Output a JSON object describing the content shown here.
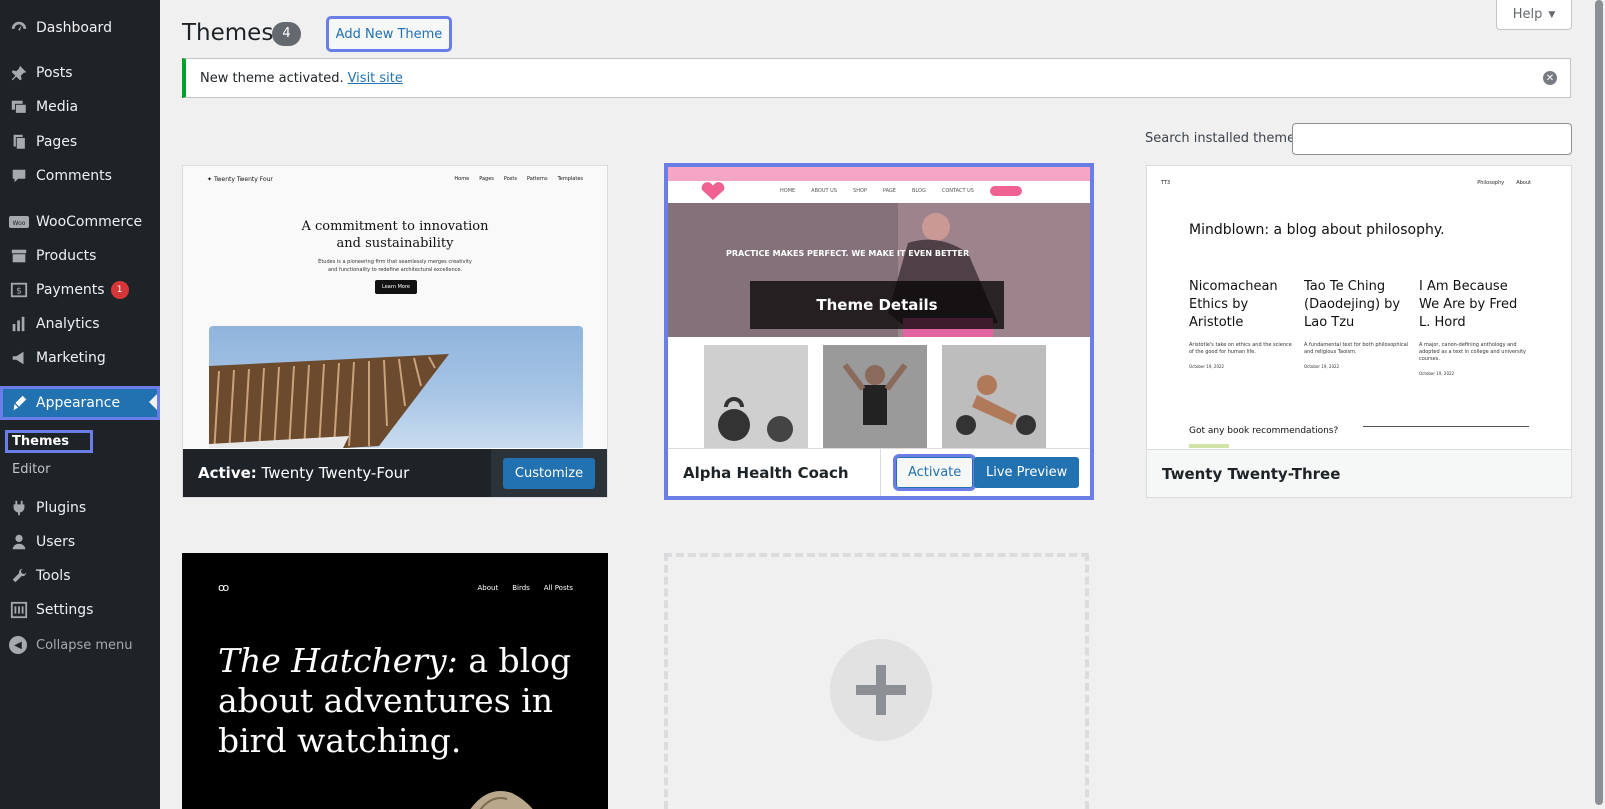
{
  "sidebar": {
    "items": [
      {
        "label": "Dashboard",
        "icon": "dashboard-icon"
      },
      {
        "label": "Posts",
        "icon": "pin-icon"
      },
      {
        "label": "Media",
        "icon": "media-icon"
      },
      {
        "label": "Pages",
        "icon": "pages-icon"
      },
      {
        "label": "Comments",
        "icon": "comment-icon"
      },
      {
        "label": "WooCommerce",
        "icon": "woocommerce-icon"
      },
      {
        "label": "Products",
        "icon": "archive-icon"
      },
      {
        "label": "Payments",
        "icon": "dollar-icon",
        "badge": "1"
      },
      {
        "label": "Analytics",
        "icon": "bar-chart-icon"
      },
      {
        "label": "Marketing",
        "icon": "megaphone-icon"
      },
      {
        "label": "Appearance",
        "icon": "paintbrush-icon"
      },
      {
        "label": "Plugins",
        "icon": "plugin-icon"
      },
      {
        "label": "Users",
        "icon": "user-icon"
      },
      {
        "label": "Tools",
        "icon": "wrench-icon"
      },
      {
        "label": "Settings",
        "icon": "settings-icon"
      }
    ],
    "submenu": {
      "themes": "Themes",
      "editor": "Editor"
    },
    "collapse_label": "Collapse menu"
  },
  "header": {
    "title": "Themes",
    "count": "4",
    "add_new_label": "Add New Theme",
    "help_label": "Help"
  },
  "notice": {
    "text": "New theme activated.",
    "link": "Visit site"
  },
  "search": {
    "label": "Search installed themes",
    "placeholder": ""
  },
  "themes": {
    "active": {
      "prefix": "Active:",
      "name": "Twenty Twenty-Four",
      "customize_label": "Customize",
      "preview": {
        "brand": "Twenty Twenty Four",
        "nav": [
          "Home",
          "Pages",
          "Posts",
          "Patterns",
          "Templates"
        ],
        "heading_line1": "A commitment to innovation",
        "heading_line2": "and sustainability",
        "sub_line1": "Études is a pioneering firm that seamlessly merges creativity",
        "sub_line2": "and functionality to redefine architectural excellence.",
        "button": "Learn More"
      }
    },
    "alpha": {
      "name": "Alpha Health Coach",
      "activate_label": "Activate",
      "live_preview_label": "Live Preview",
      "details_label": "Theme Details",
      "preview": {
        "hero": "PRACTICE MAKES PERFECT. WE MAKE IT EVEN BETTER",
        "nav": [
          "HOME",
          "ABOUT US",
          "SHOP",
          "PAGE",
          "BLOG",
          "CONTACT US"
        ]
      }
    },
    "tt3": {
      "name": "Twenty Twenty-Three",
      "preview": {
        "site": "TT3",
        "nav": [
          "Philosophy",
          "About"
        ],
        "heading": "Mindblown: a blog about philosophy.",
        "posts": [
          {
            "title": "Nicomachean Ethics by Aristotle",
            "excerpt": "Aristotle's take on ethics and the science of the good for human life.",
            "date": "October 19, 2022"
          },
          {
            "title": "Tao Te Ching (Daodejing) by Lao Tzu",
            "excerpt": "A fundamental text for both philosophical and religious Taoism.",
            "date": "October 19, 2022"
          },
          {
            "title": "I Am Because We Are by Fred L. Hord",
            "excerpt": "A major, canon-defining anthology and adopted as a text in college and university courses.",
            "date": "October 19, 2022"
          }
        ],
        "footer": "Got any book recommendations?"
      }
    },
    "hatchery": {
      "preview": {
        "logo": "ꝏ",
        "nav": [
          "About",
          "Birds",
          "All Posts"
        ],
        "title_italic": "The Hatchery:",
        "title_rest": "a blog about adventures in bird watching."
      }
    }
  },
  "colors": {
    "sidebar_bg": "#1d2327",
    "accent": "#2271b1",
    "notice_success": "#00a32a",
    "focus_outline": "#6b7ee8",
    "badge": "#d63638"
  }
}
